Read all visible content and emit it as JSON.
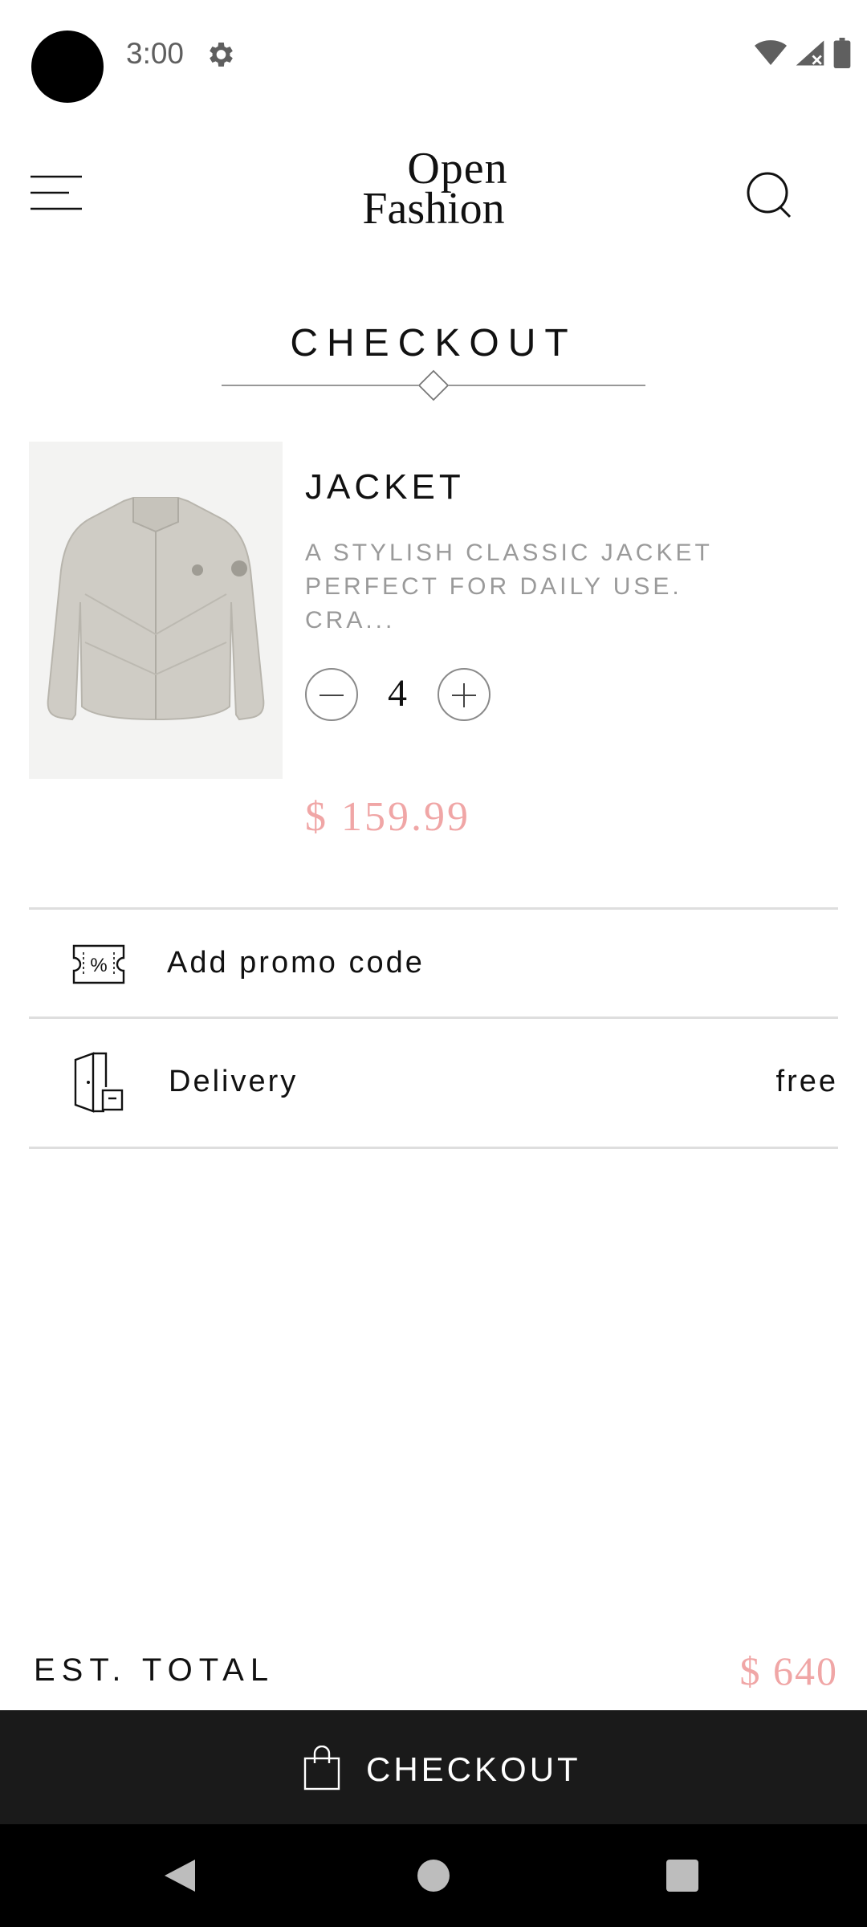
{
  "status_bar": {
    "time": "3:00",
    "icons": [
      "camera-dot",
      "gear-icon",
      "wifi-icon",
      "signal-icon",
      "battery-icon"
    ]
  },
  "header": {
    "logo_line1": "Open",
    "logo_line2": "Fashion",
    "icons": [
      "menu-icon",
      "search-icon"
    ]
  },
  "page": {
    "title": "CHECKOUT"
  },
  "cart_item": {
    "name": "JACKET",
    "description": "A STYLISH CLASSIC JACKET PERFECT FOR DAILY USE. CRA...",
    "quantity": "4",
    "price": "$ 159.99"
  },
  "promo": {
    "label": "Add promo code",
    "icon": "promo-ticket-icon"
  },
  "delivery": {
    "label": "Delivery",
    "value": "free",
    "icon": "delivery-door-icon"
  },
  "total": {
    "label": "EST. TOTAL",
    "value": "$ 640"
  },
  "checkout_button": {
    "label": "CHECKOUT",
    "icon": "shopping-bag-icon"
  },
  "colors": {
    "accent_price": "#f0a6a6",
    "checkout_bar": "#1a1a1a",
    "text": "#111111",
    "muted_text": "#9a9a9a"
  }
}
